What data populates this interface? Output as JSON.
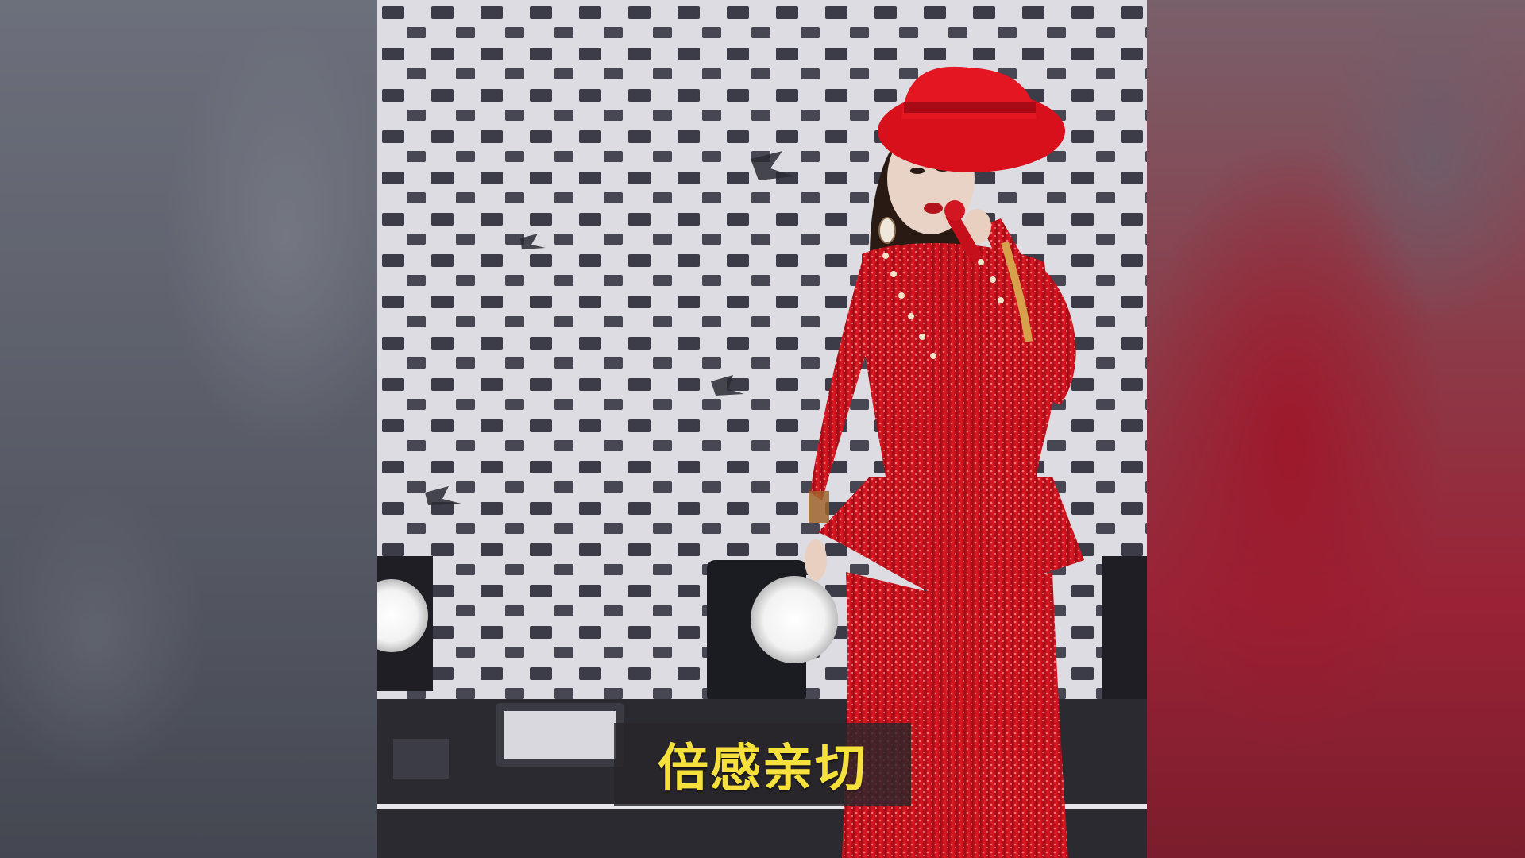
{
  "caption": {
    "text": "倍感亲切"
  },
  "scene": {
    "subject": "singer-in-red-sequin-suit",
    "colors": {
      "suit": "#d4141f",
      "hat": "#e0101c",
      "backdrop": "#d6d6dc",
      "backdrop_tile": "#3a3a44",
      "caption_text": "#f6e13c",
      "caption_bg": "#28262a"
    }
  }
}
